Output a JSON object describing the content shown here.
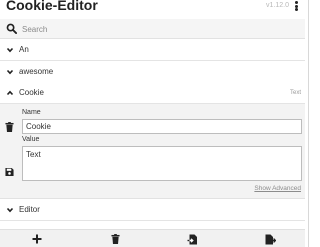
{
  "header": {
    "title": "Cookie-Editor",
    "version": "v1.12.0",
    "menu_icon": "kebab-menu-icon"
  },
  "search": {
    "placeholder": "Search",
    "value": "",
    "icon": "search-icon"
  },
  "cookies": [
    {
      "label": "An",
      "expanded": false
    },
    {
      "label": "awesome",
      "expanded": false
    },
    {
      "label": "Cookie",
      "expanded": true,
      "type_label": "Text"
    },
    {
      "label": "Editor",
      "expanded": false
    }
  ],
  "editor": {
    "name_label": "Name",
    "name_value": "Cookie",
    "value_label": "Value",
    "value_value": "Text",
    "show_advanced": "Show Advanced",
    "delete_icon": "trash-icon",
    "save_icon": "save-icon"
  },
  "toolbar": {
    "buttons": [
      {
        "icon": "add-icon"
      },
      {
        "icon": "trash-icon"
      },
      {
        "icon": "import-icon"
      },
      {
        "icon": "export-icon"
      }
    ]
  },
  "colors": {
    "background": "#ffffff",
    "panel": "#f3f3f3",
    "border": "#e4e4e4",
    "text": "#222222",
    "muted": "#9a9a9a"
  }
}
